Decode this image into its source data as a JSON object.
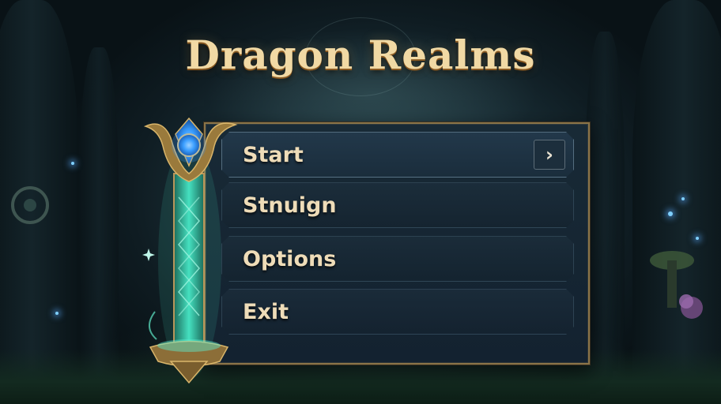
{
  "game": {
    "title": "Dragon Realms"
  },
  "menu": {
    "items": [
      {
        "label": "Start",
        "selected": true
      },
      {
        "label": "Stnuign",
        "selected": false
      },
      {
        "label": "Options",
        "selected": false
      },
      {
        "label": "Exit",
        "selected": false
      }
    ],
    "selected_arrow": "›"
  },
  "icons": {
    "arrow": "chevron-right-icon",
    "staff": "magic-staff-icon"
  },
  "colors": {
    "title": "#f1d9a4",
    "panel_border": "#8a7448",
    "label": "#eedcb8",
    "staff_glow": "#45e0c0",
    "gem": "#3aa0ff"
  }
}
